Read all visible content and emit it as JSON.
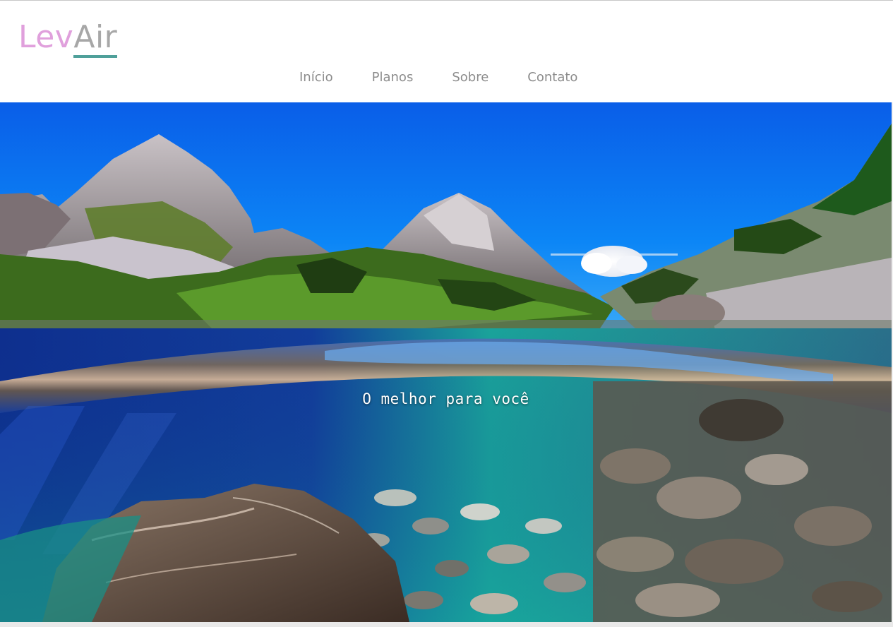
{
  "brand": {
    "part_a": "Lev",
    "part_b": "Air"
  },
  "nav": {
    "items": [
      {
        "label": "Início"
      },
      {
        "label": "Planos"
      },
      {
        "label": "Sobre"
      },
      {
        "label": "Contato"
      }
    ]
  },
  "hero": {
    "title": "O melhor para você",
    "image_description_icon": "mountain-lake-split-view-image"
  },
  "colors": {
    "brand_primary": "#e0a0dc",
    "brand_secondary": "#a7a7a7",
    "underline_accent": "#4fa09a",
    "nav_text": "#8c8c8c"
  }
}
